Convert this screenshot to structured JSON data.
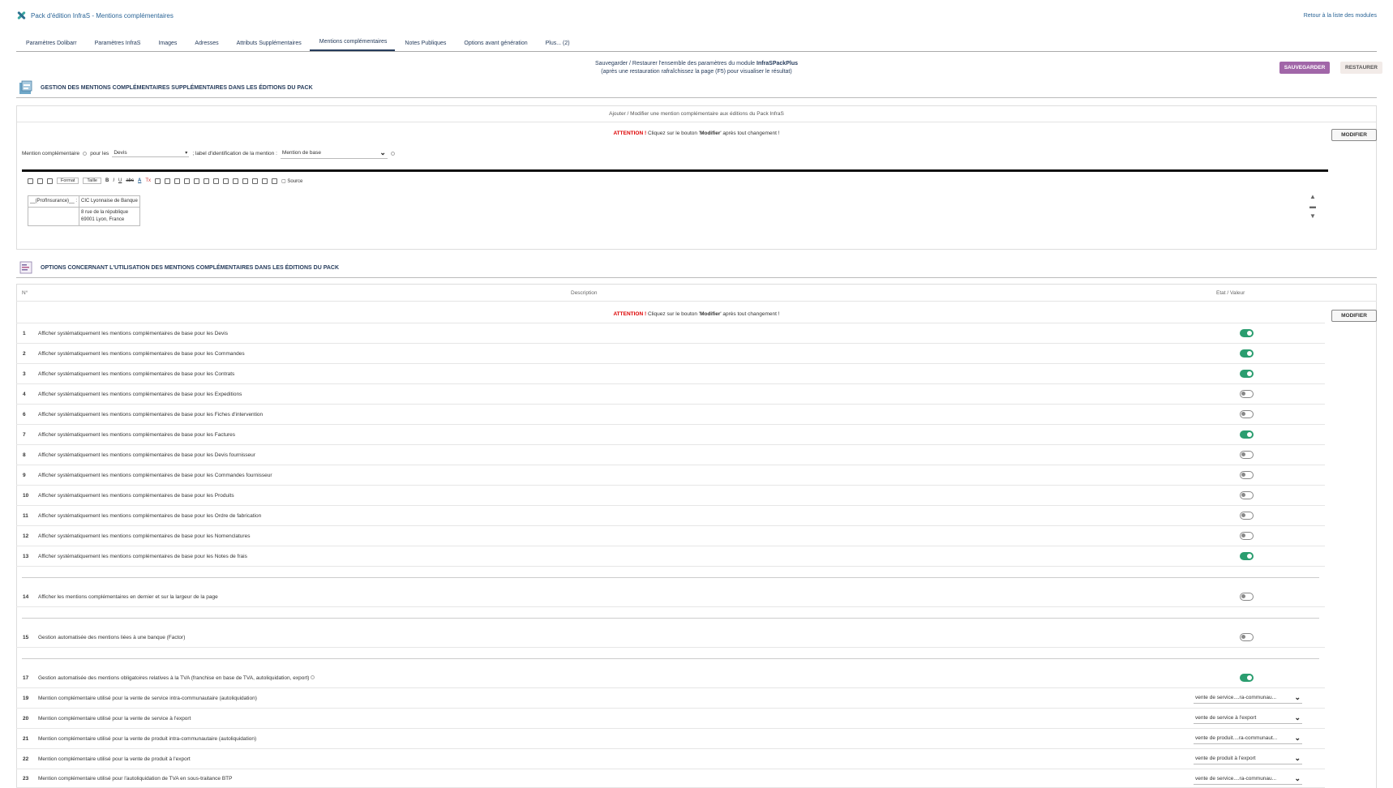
{
  "header": {
    "title": "Pack d'édition InfraS - Mentions complémentaires",
    "back_link": "Retour à la liste des modules"
  },
  "tabs": [
    {
      "label": "Paramètres Dolibarr"
    },
    {
      "label": "Paramètres InfraS"
    },
    {
      "label": "Images"
    },
    {
      "label": "Adresses"
    },
    {
      "label": "Attributs Supplémentaires"
    },
    {
      "label": "Mentions complémentaires",
      "active": true
    },
    {
      "label": "Notes Publiques"
    },
    {
      "label": "Options avant génération"
    },
    {
      "label": "Plus... (2)"
    }
  ],
  "save": {
    "line1_prefix": "Sauvegarder / Restaurer l'ensemble des paramètres du module ",
    "module_name": "InfraSPackPlus",
    "line2": "(après une restauration rafraîchissez la page (F5) pour visualiser le résultat)",
    "save_label": "SAUVEGARDER",
    "restore_label": "RESTAURER"
  },
  "section1": {
    "title": "GESTION DES MENTIONS COMPLÉMENTAIRES SUPPLÉMENTAIRES DANS LES ÉDITIONS DU PACK",
    "box_title": "Ajouter / Modifier une mention complémentaire aux éditions du Pack InfraS",
    "attention_label": "ATTENTION !",
    "attention_text_a": " Cliquez sur le bouton '",
    "attention_bold": "Modifier",
    "attention_text_b": "' après tout changement !",
    "modify_label": "MODIFIER",
    "form": {
      "label_mention": "Mention complémentaire",
      "label_pour": "pour les",
      "pour_value": "Devis",
      "label_ident": "; label d'identification de la mention :",
      "ident_value": "Mention de base"
    },
    "toolbar": {
      "format": "Format",
      "size": "Taille",
      "source": "Source"
    },
    "editor": {
      "cell1": "__(ProfInsurance)__ :",
      "cell2": "CIC Lyonnaise de Banque",
      "cell3_line1": "8 rue de la république",
      "cell3_line2": "69001 Lyon, France"
    }
  },
  "section2": {
    "title": "OPTIONS CONCERNANT L'UTILISATION DES MENTIONS COMPLÉMENTAIRES DANS LES ÉDITIONS DU PACK",
    "col_num": "N°",
    "col_desc": "Description",
    "col_state": "Etat / Valeur",
    "modify_label": "MODIFIER",
    "rows": [
      {
        "num": "1",
        "desc": "Afficher systématiquement les mentions complémentaires de base pour les Devis",
        "on": true
      },
      {
        "num": "2",
        "desc": "Afficher systématiquement les mentions complémentaires de base pour les Commandes",
        "on": true
      },
      {
        "num": "3",
        "desc": "Afficher systématiquement les mentions complémentaires de base pour les Contrats",
        "on": true
      },
      {
        "num": "4",
        "desc": "Afficher systématiquement les mentions complémentaires de base pour les Expeditions",
        "on": false
      },
      {
        "num": "6",
        "desc": "Afficher systématiquement les mentions complémentaires de base pour les Fiches d'intervention",
        "on": false
      },
      {
        "num": "7",
        "desc": "Afficher systématiquement les mentions complémentaires de base pour les Factures",
        "on": true
      },
      {
        "num": "8",
        "desc": "Afficher systématiquement les mentions complémentaires de base pour les Devis fournisseur",
        "on": false
      },
      {
        "num": "9",
        "desc": "Afficher systématiquement les mentions complémentaires de base pour les Commandes fournisseur",
        "on": false
      },
      {
        "num": "10",
        "desc": "Afficher systématiquement les mentions complémentaires de base pour les Produits",
        "on": false
      },
      {
        "num": "11",
        "desc": "Afficher systématiquement les mentions complémentaires de base pour les Ordre de fabrication",
        "on": false
      },
      {
        "num": "12",
        "desc": "Afficher systématiquement les mentions complémentaires de base pour les Nomenclatures",
        "on": false
      },
      {
        "num": "13",
        "desc": "Afficher systématiquement les mentions complémentaires de base pour les Notes de frais",
        "on": true
      },
      {
        "num": "14",
        "desc": "Afficher les mentions complémentaires en dernier et sur la largeur de la page",
        "on": false
      },
      {
        "num": "15",
        "desc": "Gestion automatisée des mentions liées à une banque (Factor)",
        "on": false
      },
      {
        "num": "17",
        "desc": "Gestion automatisée des mentions obligatoires relatives à la TVA (franchise en base de TVA, autoliquidation, export)",
        "on": true
      }
    ],
    "select_rows": [
      {
        "num": "19",
        "desc": "Mention complémentaire utilisé pour la vente de service intra-communautaire (autoliquidation)",
        "value": "vente de service....ra-communau..."
      },
      {
        "num": "20",
        "desc": "Mention complémentaire utilisé pour la vente de service à l'export",
        "value": "vente de service à l'export"
      },
      {
        "num": "21",
        "desc": "Mention complémentaire utilisé pour la vente de produit intra-communautaire (autoliquidation)",
        "value": "vente de produit....ra-communaut..."
      },
      {
        "num": "22",
        "desc": "Mention complémentaire utilisé pour la vente de produit à l'export",
        "value": "vente de produit à l'export"
      },
      {
        "num": "23",
        "desc": "Mention complémentaire utilisé pour l'autoliquidation de TVA en sous-traitance BTP",
        "value": "vente de service....ra-communau..."
      }
    ]
  },
  "colors": {
    "accent": "#263c5c",
    "toggle_on": "#2a9d6f",
    "save_button": "#a166a8",
    "attention": "#dd0000"
  }
}
